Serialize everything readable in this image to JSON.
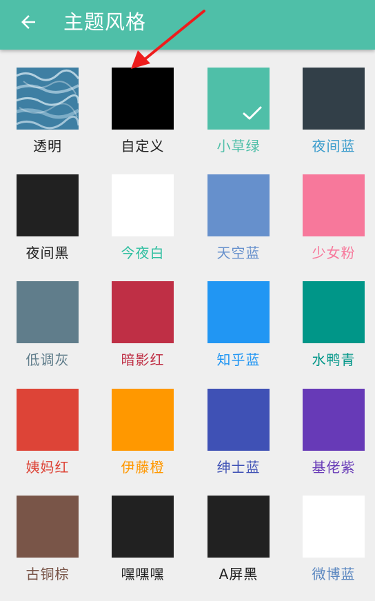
{
  "header": {
    "title": "主题风格",
    "back_icon": "arrow-left-icon",
    "background": "#4fbfa8"
  },
  "selected_theme": "小草绿",
  "themes": [
    {
      "label": "透明",
      "swatch": "#3e7fa3",
      "label_color": "#222222",
      "pattern": "water"
    },
    {
      "label": "自定义",
      "swatch": "#000000",
      "label_color": "#222222"
    },
    {
      "label": "小草绿",
      "swatch": "#4fbfa8",
      "label_color": "#4fbfa8",
      "selected": true
    },
    {
      "label": "夜间蓝",
      "swatch": "#323f48",
      "label_color": "#3b9ccc"
    },
    {
      "label": "夜间黑",
      "swatch": "#212121",
      "label_color": "#222222"
    },
    {
      "label": "今夜白",
      "swatch": "#ffffff",
      "label_color": "#2fbfa0"
    },
    {
      "label": "天空蓝",
      "swatch": "#6690cc",
      "label_color": "#6690cc"
    },
    {
      "label": "少女粉",
      "swatch": "#f7789b",
      "label_color": "#f7789b"
    },
    {
      "label": "低调灰",
      "swatch": "#607d8b",
      "label_color": "#607d8b"
    },
    {
      "label": "暗影红",
      "swatch": "#bf2f45",
      "label_color": "#bf2f45"
    },
    {
      "label": "知乎蓝",
      "swatch": "#2196f3",
      "label_color": "#2196f3"
    },
    {
      "label": "水鸭青",
      "swatch": "#009688",
      "label_color": "#009688"
    },
    {
      "label": "姨妈红",
      "swatch": "#dd4437",
      "label_color": "#dd4437"
    },
    {
      "label": "伊藤橙",
      "swatch": "#ff9800",
      "label_color": "#ff9800"
    },
    {
      "label": "绅士蓝",
      "swatch": "#3f51b5",
      "label_color": "#3f51b5"
    },
    {
      "label": "基佬紫",
      "swatch": "#673ab7",
      "label_color": "#673ab7"
    },
    {
      "label": "古铜棕",
      "swatch": "#795548",
      "label_color": "#795548"
    },
    {
      "label": "嘿嘿嘿",
      "swatch": "#212121",
      "label_color": "#222222"
    },
    {
      "label": "A屏黑",
      "swatch": "#212121",
      "label_color": "#222222"
    },
    {
      "label": "微博蓝",
      "swatch": "#ffffff",
      "label_color": "#5b87c0"
    }
  ],
  "annotation": {
    "color": "#ee1c1c",
    "icon": "red-arrow-annotation"
  }
}
